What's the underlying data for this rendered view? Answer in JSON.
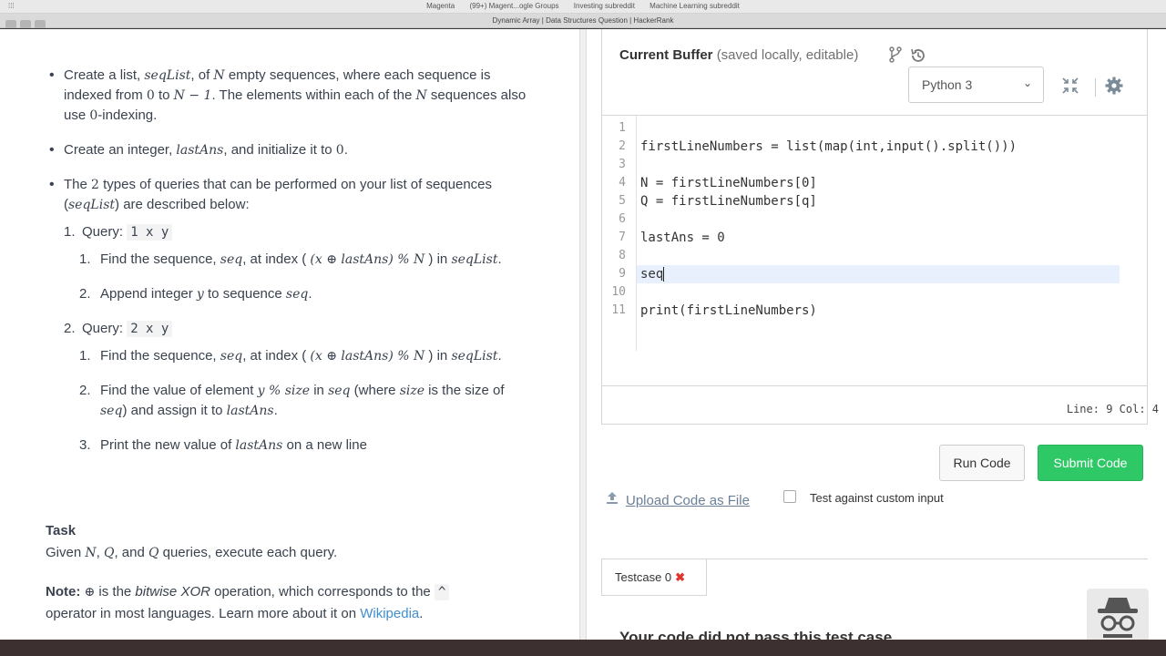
{
  "bookmarks": [
    "Magenta",
    "(99+) Magent...ogle Groups",
    "Investing subreddit",
    "Machine Learning subreddit"
  ],
  "window_title": "Dynamic Array | Data Structures Question | HackerRank",
  "problem": {
    "b1_a": "Create a list, ",
    "b1_m1": "seqList",
    "b1_b": ", of ",
    "b1_m2": "N",
    "b1_c": " empty sequences, where each sequence is indexed from ",
    "b1_m3": "0",
    "b1_d": " to ",
    "b1_m4": "N − 1",
    "b1_e": ". The elements within each of the ",
    "b1_m5": "N",
    "b1_f": " sequences also use ",
    "b1_m6": "0",
    "b1_g": "-indexing.",
    "b2_a": "Create an integer, ",
    "b2_m1": "lastAns",
    "b2_b": ", and initialize it to ",
    "b2_m2": "0",
    "b2_c": ".",
    "b3_a": "The ",
    "b3_m1": "2",
    "b3_b": " types of queries that can be performed on your list of sequences (",
    "b3_m2": "seqList",
    "b3_c": ") are described below:",
    "q1_num": "1.",
    "q1_label": "Query: ",
    "q1_code": "1 x y",
    "q1_s1_num": "1.",
    "q1_s1_a": "Find the sequence, ",
    "q1_s1_m1": "seq",
    "q1_s1_b": ", at index ( ",
    "q1_s1_m2": "(x ⊕ lastAns) % N",
    "q1_s1_c": " ) in ",
    "q1_s1_m3": "seqList",
    "q1_s1_d": ".",
    "q1_s2_num": "2.",
    "q1_s2_a": "Append integer ",
    "q1_s2_m1": "y",
    "q1_s2_b": " to sequence ",
    "q1_s2_m2": "seq",
    "q1_s2_c": ".",
    "q2_num": "2.",
    "q2_label": "Query: ",
    "q2_code": "2 x y",
    "q2_s1_num": "1.",
    "q2_s1_a": "Find the sequence, ",
    "q2_s1_m1": "seq",
    "q2_s1_b": ", at index ( ",
    "q2_s1_m2": "(x ⊕ lastAns) % N",
    "q2_s1_c": " ) in ",
    "q2_s1_m3": "seqList",
    "q2_s1_d": ".",
    "q2_s2_num": "2.",
    "q2_s2_a": "Find the value of element ",
    "q2_s2_m1": "y % size",
    "q2_s2_b": " in ",
    "q2_s2_m2": "seq",
    "q2_s2_c": " (where ",
    "q2_s2_m3": "size",
    "q2_s2_d": " is the size of ",
    "q2_s2_m4": "seq",
    "q2_s2_e": ") and assign it to ",
    "q2_s2_m5": "lastAns",
    "q2_s2_f": ".",
    "q2_s3_num": "3.",
    "q2_s3_a": "Print the new value of ",
    "q2_s3_m1": "lastAns",
    "q2_s3_b": " on a new line",
    "task_title": "Task",
    "task_a": "Given ",
    "task_m1": "N",
    "task_b": ", ",
    "task_m2": "Q",
    "task_c": ", and ",
    "task_m3": "Q",
    "task_d": " queries, execute each query.",
    "note_label": "Note:",
    "note_sym": "⊕",
    "note_a": " is the ",
    "note_em": "bitwise XOR",
    "note_b": " operation, which corresponds to the ",
    "note_caret": "^",
    "note_c": " operator in most languages. Learn more about it on ",
    "note_link": "Wikipedia",
    "note_d": "."
  },
  "editor": {
    "title": "Current Buffer",
    "subtitle": "(saved locally, editable)",
    "language": "Python 3",
    "lines": [
      {
        "n": "1",
        "t": ""
      },
      {
        "n": "2",
        "t": "firstLineNumbers = list(map(int,input().split()))"
      },
      {
        "n": "3",
        "t": ""
      },
      {
        "n": "4",
        "t": "N = firstLineNumbers[0]"
      },
      {
        "n": "5",
        "t": "Q = firstLineNumbers[q]"
      },
      {
        "n": "6",
        "t": ""
      },
      {
        "n": "7",
        "t": "lastAns = 0"
      },
      {
        "n": "8",
        "t": ""
      },
      {
        "n": "9",
        "t": "seq"
      },
      {
        "n": "10",
        "t": ""
      },
      {
        "n": "11",
        "t": "print(firstLineNumbers)"
      }
    ],
    "status": "Line: 9 Col: 4"
  },
  "actions": {
    "run": "Run Code",
    "submit": "Submit Code",
    "upload": "Upload Code as File",
    "custom_input": "Test against custom input"
  },
  "testcase": {
    "tab": "Testcase 0",
    "message": "Your code did not pass this test case."
  },
  "colors": {
    "submit": "#2ec866",
    "link": "#3e8ed0",
    "error": "#e0342c"
  }
}
